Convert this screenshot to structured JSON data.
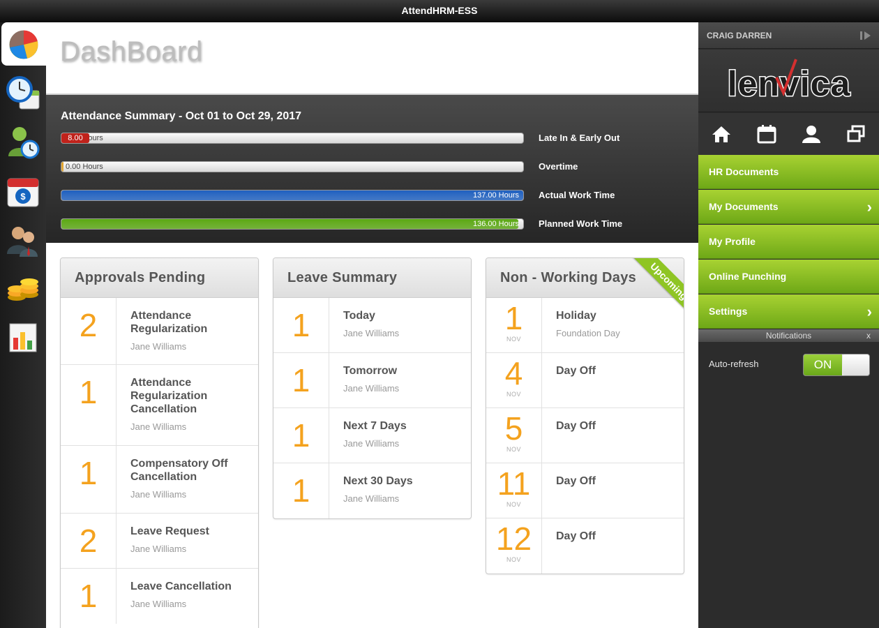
{
  "window": {
    "title": "AttendHRM-ESS"
  },
  "left_rail": {
    "icons": [
      "dashboard-pie-icon",
      "clock-calendar-icon",
      "employee-clock-icon",
      "payroll-calendar-icon",
      "people-icon",
      "coins-icon",
      "reports-chart-icon"
    ]
  },
  "page": {
    "title": "DashBoard"
  },
  "attendance": {
    "title": "Attendance Summary - Oct 01 to Oct 29, 2017",
    "bars": [
      {
        "label": "Late In & Early Out",
        "text": "8.00 Hours",
        "badge": "8.00",
        "fill_fraction": 0.06,
        "color": "#c0221b"
      },
      {
        "label": "Overtime",
        "text": "0.00 Hours",
        "fill_fraction": 0.0,
        "color": "#e3a020"
      },
      {
        "label": "Actual Work Time",
        "text": "137.00 Hours",
        "fill_fraction": 1.0,
        "color": "#1e5fbf"
      },
      {
        "label": "Planned Work Time",
        "text": "136.00 Hours",
        "fill_fraction": 0.99,
        "color": "#5aa712"
      }
    ]
  },
  "approvals": {
    "title": "Approvals Pending",
    "items": [
      {
        "count": "2",
        "title": "Attendance Regularization",
        "sub": "Jane Williams"
      },
      {
        "count": "1",
        "title": "Attendance Regularization Cancellation",
        "sub": "Jane Williams"
      },
      {
        "count": "1",
        "title": "Compensatory Off Cancellation",
        "sub": "Jane Williams"
      },
      {
        "count": "2",
        "title": "Leave Request",
        "sub": "Jane Williams"
      },
      {
        "count": "1",
        "title": "Leave Cancellation",
        "sub": "Jane Williams"
      }
    ]
  },
  "leave_summary": {
    "title": "Leave Summary",
    "items": [
      {
        "count": "1",
        "title": "Today",
        "sub": "Jane Williams"
      },
      {
        "count": "1",
        "title": "Tomorrow",
        "sub": "Jane Williams"
      },
      {
        "count": "1",
        "title": "Next 7 Days",
        "sub": "Jane Williams"
      },
      {
        "count": "1",
        "title": "Next 30 Days",
        "sub": "Jane Williams"
      }
    ]
  },
  "non_working": {
    "title": "Non - Working Days",
    "ribbon": "Upcoming",
    "items": [
      {
        "day": "1",
        "month": "NOV",
        "title": "Holiday",
        "sub": "Foundation Day"
      },
      {
        "day": "4",
        "month": "NOV",
        "title": "Day Off",
        "sub": ""
      },
      {
        "day": "5",
        "month": "NOV",
        "title": "Day Off",
        "sub": ""
      },
      {
        "day": "11",
        "month": "NOV",
        "title": "Day Off",
        "sub": ""
      },
      {
        "day": "12",
        "month": "NOV",
        "title": "Day Off",
        "sub": ""
      }
    ]
  },
  "right_panel": {
    "user_name": "CRAIG DARREN",
    "logo_text": "lenvica",
    "quick_icons": [
      "home-icon",
      "calendar-icon",
      "user-icon",
      "windows-icon"
    ],
    "menu": [
      {
        "label": "HR Documents",
        "has_chevron": false
      },
      {
        "label": "My Documents",
        "has_chevron": true
      },
      {
        "label": "My Profile",
        "has_chevron": false
      },
      {
        "label": "Online Punching",
        "has_chevron": false
      },
      {
        "label": "Settings",
        "has_chevron": true
      }
    ],
    "notifications_label": "Notifications",
    "notifications_close": "x",
    "auto_refresh_label": "Auto-refresh",
    "toggle_state": "ON",
    "accent_color": "#8fc524"
  }
}
